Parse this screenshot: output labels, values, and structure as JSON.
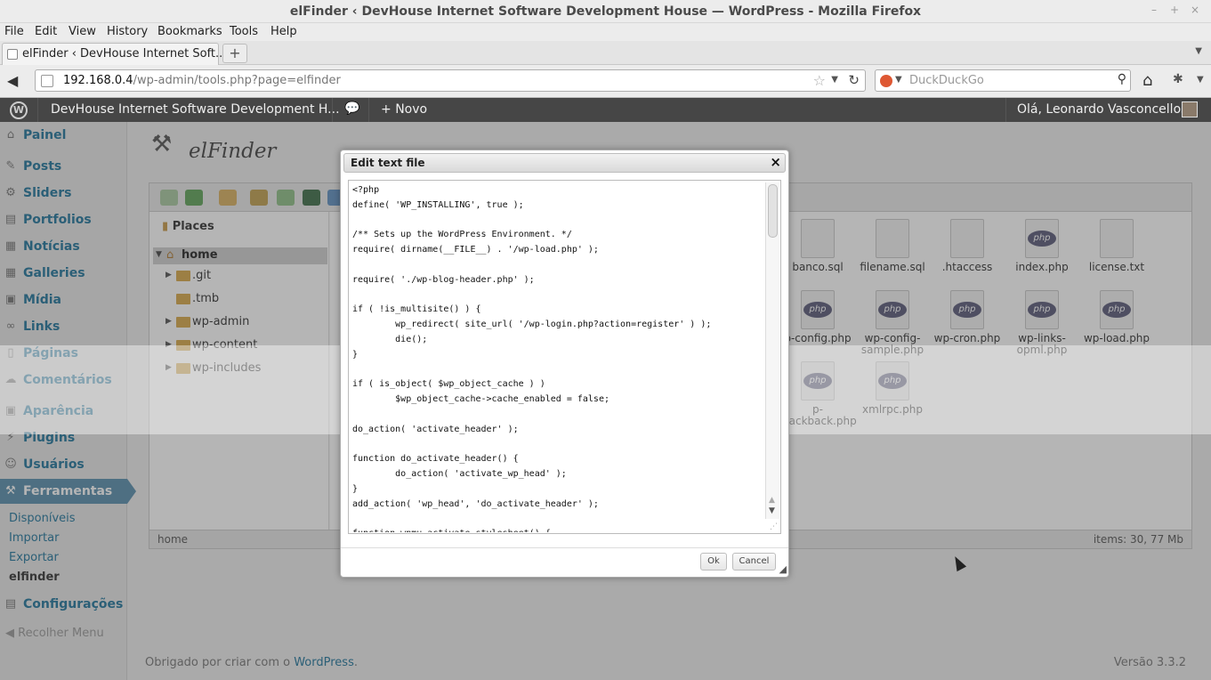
{
  "browser": {
    "window_title": "elFinder ‹ DevHouse Internet Software Development House — WordPress - Mozilla Firefox",
    "menu": [
      "File",
      "Edit",
      "View",
      "History",
      "Bookmarks",
      "Tools",
      "Help"
    ],
    "tab_label": "elFinder ‹ DevHouse Internet Soft...",
    "url_host": "192.168.0.4",
    "url_path": "/wp-admin/tools.php?page=elfinder",
    "search_placeholder": "DuckDuckGo"
  },
  "adminbar": {
    "site_name": "DevHouse Internet Software Development H...",
    "new_label": "Novo",
    "greeting": "Olá, Leonardo Vasconcellos"
  },
  "sidebar": {
    "items": [
      {
        "label": "Painel",
        "icon": "dashboard-icon"
      },
      {
        "label": "Posts",
        "icon": "pin-icon"
      },
      {
        "label": "Sliders",
        "icon": "slider-icon"
      },
      {
        "label": "Portfolios",
        "icon": "portfolio-icon"
      },
      {
        "label": "Notícias",
        "icon": "news-icon"
      },
      {
        "label": "Galleries",
        "icon": "gallery-icon"
      },
      {
        "label": "Mídia",
        "icon": "media-icon"
      },
      {
        "label": "Links",
        "icon": "link-icon"
      },
      {
        "label": "Páginas",
        "icon": "pages-icon"
      },
      {
        "label": "Comentários",
        "icon": "comments-icon"
      },
      {
        "label": "Aparência",
        "icon": "appearance-icon"
      },
      {
        "label": "Plugins",
        "icon": "plugins-icon"
      },
      {
        "label": "Usuários",
        "icon": "users-icon"
      },
      {
        "label": "Ferramentas",
        "icon": "tools-icon"
      },
      {
        "label": "Configurações",
        "icon": "settings-icon"
      }
    ],
    "tools_submenu": [
      "Disponíveis",
      "Importar",
      "Exportar",
      "elfinder"
    ],
    "collapse_label": "Recolher Menu"
  },
  "elfinder": {
    "title": "elFinder",
    "places_label": "Places",
    "tree_root": "home",
    "tree_children": [
      ".git",
      ".tmb",
      "wp-admin",
      "wp-content",
      "wp-includes"
    ],
    "files": [
      {
        "name": "banco.sql",
        "type": "text"
      },
      {
        "name": "filename.sql",
        "type": "text"
      },
      {
        "name": ".htaccess",
        "type": "text"
      },
      {
        "name": "index.php",
        "type": "php"
      },
      {
        "name": "license.txt",
        "type": "text"
      },
      {
        "name": "p-config.php",
        "type": "php"
      },
      {
        "name": "wp-config-sample.php",
        "type": "php"
      },
      {
        "name": "wp-cron.php",
        "type": "php"
      },
      {
        "name": "wp-links-opml.php",
        "type": "php"
      },
      {
        "name": "wp-load.php",
        "type": "php"
      },
      {
        "name": "p-trackback.php",
        "type": "php"
      },
      {
        "name": "xmlrpc.php",
        "type": "php"
      }
    ],
    "status_path": "home",
    "status_items": "items: 30, 77 Mb"
  },
  "dialog": {
    "title": "Edit text file",
    "code": "<?php\ndefine( 'WP_INSTALLING', true );\n\n/** Sets up the WordPress Environment. */\nrequire( dirname(__FILE__) . '/wp-load.php' );\n\nrequire( './wp-blog-header.php' );\n\nif ( !is_multisite() ) {\n        wp_redirect( site_url( '/wp-login.php?action=register' ) );\n        die();\n}\n\nif ( is_object( $wp_object_cache ) )\n        $wp_object_cache->cache_enabled = false;\n\ndo_action( 'activate_header' );\n\nfunction do_activate_header() {\n        do_action( 'activate_wp_head' );\n}\nadd_action( 'wp_head', 'do_activate_header' );\n\nfunction wpmu_activate_stylesheet() {",
    "ok_label": "Ok",
    "cancel_label": "Cancel"
  },
  "footer": {
    "thanks_prefix": "Obrigado por criar com o",
    "thanks_link": "WordPress",
    "thanks_suffix": ".",
    "version": "Versão 3.3.2"
  },
  "colors": {
    "wp_link": "#21759b",
    "active_menu": "#5a8fad",
    "adminbar": "#464646"
  }
}
